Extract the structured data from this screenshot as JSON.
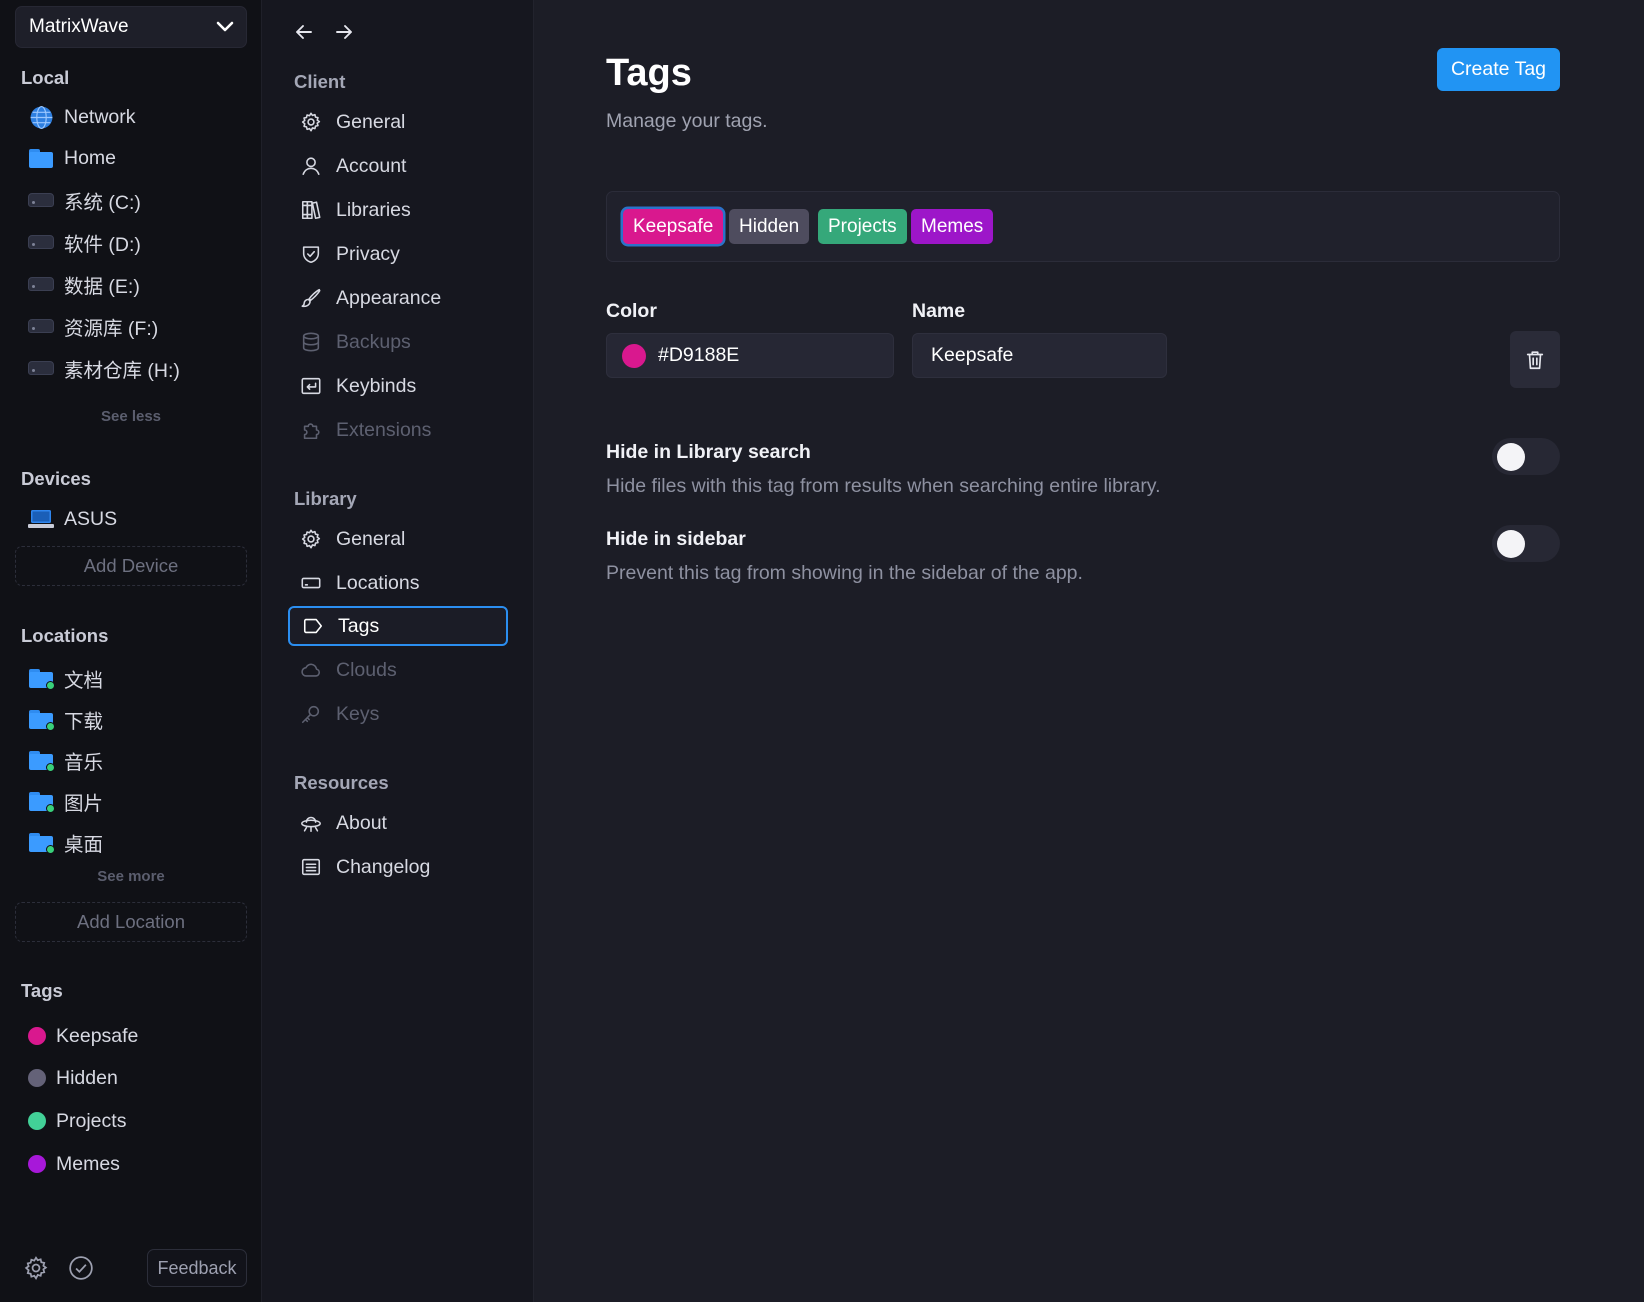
{
  "library_switcher": {
    "name": "MatrixWave"
  },
  "sidebar": {
    "local_heading": "Local",
    "local_items": [
      {
        "label": "Network",
        "icon": "globe-icon"
      },
      {
        "label": "Home",
        "icon": "home-folder-icon"
      },
      {
        "label": "系统 (C:)",
        "icon": "drive-icon"
      },
      {
        "label": "软件 (D:)",
        "icon": "drive-icon"
      },
      {
        "label": "数据 (E:)",
        "icon": "drive-icon"
      },
      {
        "label": "资源库 (F:)",
        "icon": "drive-icon"
      },
      {
        "label": "素材仓库 (H:)",
        "icon": "drive-icon"
      }
    ],
    "local_toggle": "See less",
    "devices_heading": "Devices",
    "devices": [
      {
        "label": "ASUS",
        "icon": "laptop-icon"
      }
    ],
    "add_device": "Add Device",
    "locations_heading": "Locations",
    "locations": [
      {
        "label": "文档"
      },
      {
        "label": "下载"
      },
      {
        "label": "音乐"
      },
      {
        "label": "图片"
      },
      {
        "label": "桌面"
      }
    ],
    "locations_toggle": "See more",
    "add_location": "Add Location",
    "tags_heading": "Tags",
    "tags": [
      {
        "label": "Keepsafe",
        "color": "#D9188E"
      },
      {
        "label": "Hidden",
        "color": "#646278"
      },
      {
        "label": "Projects",
        "color": "#42D097"
      },
      {
        "label": "Memes",
        "color": "#A718D9"
      }
    ],
    "feedback": "Feedback"
  },
  "settings_nav": {
    "client_heading": "Client",
    "client_items": [
      {
        "label": "General",
        "icon": "gear-icon",
        "enabled": true
      },
      {
        "label": "Account",
        "icon": "user-icon",
        "enabled": true
      },
      {
        "label": "Libraries",
        "icon": "books-icon",
        "enabled": true
      },
      {
        "label": "Privacy",
        "icon": "shield-check-icon",
        "enabled": true
      },
      {
        "label": "Appearance",
        "icon": "paintbrush-icon",
        "enabled": true
      },
      {
        "label": "Backups",
        "icon": "database-icon",
        "enabled": false
      },
      {
        "label": "Keybinds",
        "icon": "keyboard-return-icon",
        "enabled": true
      },
      {
        "label": "Extensions",
        "icon": "puzzle-icon",
        "enabled": false
      }
    ],
    "library_heading": "Library",
    "library_items": [
      {
        "label": "General",
        "icon": "gear-icon",
        "enabled": true
      },
      {
        "label": "Locations",
        "icon": "hard-drive-icon",
        "enabled": true
      },
      {
        "label": "Tags",
        "icon": "tag-icon",
        "enabled": true,
        "active": true
      },
      {
        "label": "Clouds",
        "icon": "cloud-icon",
        "enabled": false
      },
      {
        "label": "Keys",
        "icon": "key-icon",
        "enabled": false
      }
    ],
    "resources_heading": "Resources",
    "resources_items": [
      {
        "label": "About",
        "icon": "ufo-icon",
        "enabled": true
      },
      {
        "label": "Changelog",
        "icon": "article-icon",
        "enabled": true
      }
    ]
  },
  "main": {
    "title": "Tags",
    "subtitle": "Manage your tags.",
    "create_button": "Create Tag",
    "tag_chips": [
      {
        "label": "Keepsafe",
        "color": "#D9188E",
        "selected": true
      },
      {
        "label": "Hidden",
        "color": "#4E4C5E",
        "selected": false
      },
      {
        "label": "Projects",
        "color": "#35A87A",
        "selected": false
      },
      {
        "label": "Memes",
        "color": "#9D16C9",
        "selected": false
      }
    ],
    "color_label": "Color",
    "color_value": "#D9188E",
    "name_label": "Name",
    "name_value": "Keepsafe",
    "options": [
      {
        "title": "Hide in Library search",
        "description": "Hide files with this tag from results when searching entire library.",
        "enabled": false
      },
      {
        "title": "Hide in sidebar",
        "description": "Prevent this tag from showing in the sidebar of the app.",
        "enabled": false
      }
    ]
  },
  "colors": {
    "accent": "#2194F3",
    "background": "#1C1D26",
    "sidebar_bg": "#101116"
  }
}
